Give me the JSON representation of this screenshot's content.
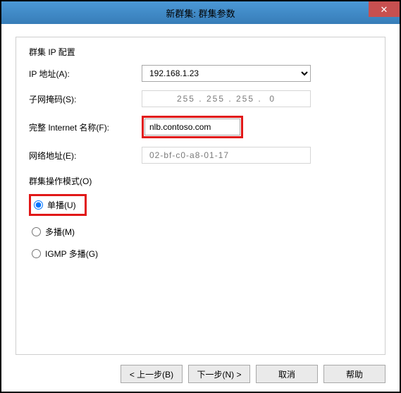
{
  "titlebar": {
    "title": "新群集: 群集参数",
    "close": "✕"
  },
  "ipConfig": {
    "groupLabel": "群集 IP 配置",
    "ipLabel": "IP 地址(A):",
    "ipValue": "192.168.1.23",
    "subnetLabel": "子网掩码(S):",
    "subnetValue": "255 . 255 . 255 .  0",
    "fqdnLabel": "完整 Internet 名称(F):",
    "fqdnValue": "nlb.contoso.com",
    "macLabel": "网络地址(E):",
    "macValue": "02-bf-c0-a8-01-17"
  },
  "modes": {
    "groupLabel": "群集操作模式(O)",
    "unicast": "单播(U)",
    "multicast": "多播(M)",
    "igmp": "IGMP 多播(G)"
  },
  "footer": {
    "back": "< 上一步(B)",
    "next": "下一步(N) >",
    "cancel": "取消",
    "help": "帮助"
  }
}
